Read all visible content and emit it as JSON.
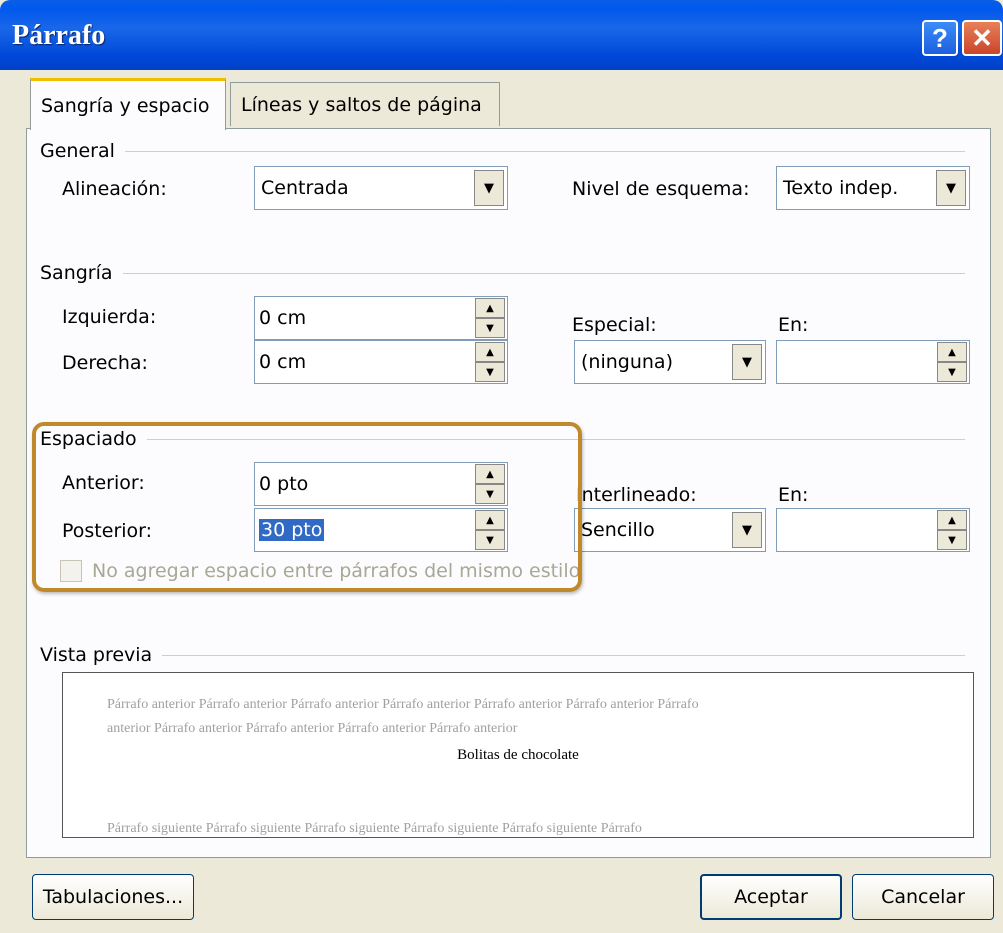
{
  "title": "Párrafo",
  "titlebar": {
    "help_symbol": "?",
    "close_symbol": "✕"
  },
  "tabs": [
    {
      "label": "Sangría y espacio",
      "active": true
    },
    {
      "label": "Líneas y saltos de página",
      "active": false
    }
  ],
  "general": {
    "section_label": "General",
    "alineacion_label": "Alineación:",
    "alineacion_value": "Centrada",
    "nivel_label": "Nivel de esquema:",
    "nivel_value": "Texto indep."
  },
  "sangria": {
    "section_label": "Sangría",
    "izquierda_label": "Izquierda:",
    "izquierda_value": "0 cm",
    "derecha_label": "Derecha:",
    "derecha_value": "0 cm",
    "especial_label": "Especial:",
    "especial_value": "(ninguna)",
    "en_label": "En:",
    "en_value": ""
  },
  "espaciado": {
    "section_label": "Espaciado",
    "anterior_label": "Anterior:",
    "anterior_value": "0 pto",
    "posterior_label": "Posterior:",
    "posterior_value": "30 pto",
    "interlineado_label": "Interlineado:",
    "interlineado_value": "Sencillo",
    "en_label": "En:",
    "en_value": "",
    "checkbox_label": "No agregar espacio entre párrafos del mismo estilo",
    "checkbox_checked": false
  },
  "preview": {
    "section_label": "Vista previa",
    "prev_line1": "Párrafo anterior Párrafo anterior Párrafo anterior Párrafo anterior Párrafo anterior Párrafo anterior Párrafo",
    "prev_line2": "anterior Párrafo anterior Párrafo anterior Párrafo anterior Párrafo anterior",
    "current": "Bolitas de chocolate",
    "next_line": "Párrafo siguiente Párrafo siguiente Párrafo siguiente Párrafo siguiente Párrafo siguiente Párrafo"
  },
  "buttons": {
    "tabulaciones": "Tabulaciones...",
    "aceptar": "Aceptar",
    "cancelar": "Cancelar"
  },
  "colors": {
    "titlebar": "#0058ee",
    "highlight": "#c08a2c",
    "selection": "#316ac5"
  }
}
